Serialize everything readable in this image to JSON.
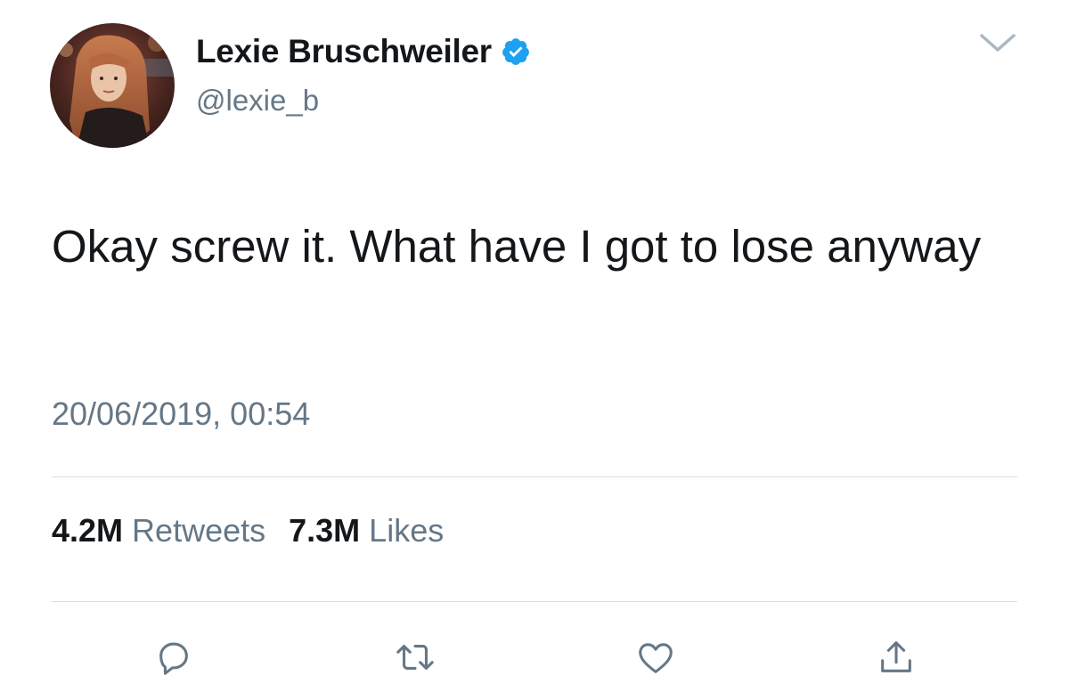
{
  "user": {
    "display_name": "Lexie Bruschweiler",
    "handle": "@lexie_b",
    "verified": true,
    "verified_color": "#1da1f2"
  },
  "tweet": {
    "text": "Okay screw it. What have I got to lose anyway",
    "timestamp": "20/06/2019, 00:54"
  },
  "stats": {
    "retweets_count": "4.2M",
    "retweets_label": "Retweets",
    "likes_count": "7.3M",
    "likes_label": "Likes"
  },
  "actions": {
    "icons": [
      "reply-icon",
      "retweet-icon",
      "like-icon",
      "share-icon"
    ]
  },
  "colors": {
    "primary_text": "#14171a",
    "secondary_text": "#657786",
    "divider": "#d8dde2",
    "icon": "#657786"
  }
}
